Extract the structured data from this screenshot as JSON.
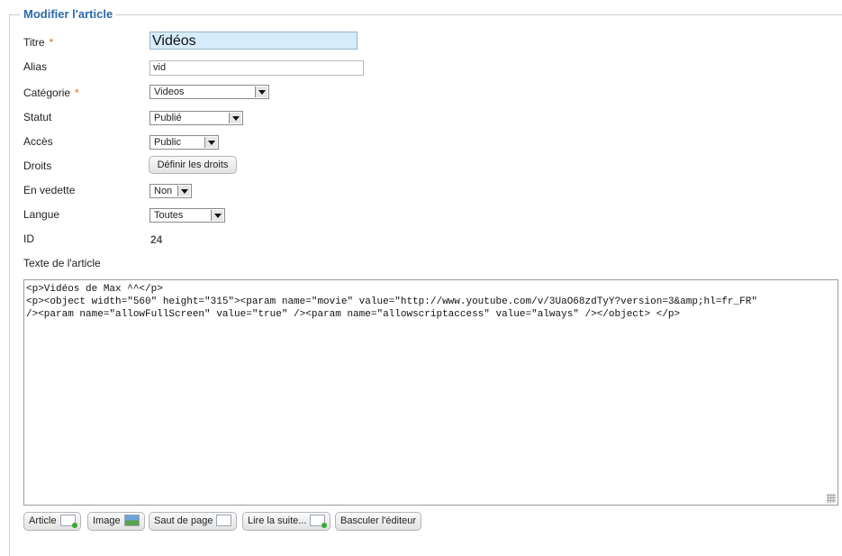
{
  "form": {
    "legend": "Modifier l'article",
    "required_marker": "*",
    "titre": {
      "label": "Titre",
      "value": "Vidéos"
    },
    "alias": {
      "label": "Alias",
      "value": "vid"
    },
    "categorie": {
      "label": "Catégorie",
      "value": "Videos"
    },
    "statut": {
      "label": "Statut",
      "value": "Publié"
    },
    "acces": {
      "label": "Accès",
      "value": "Public"
    },
    "droits": {
      "label": "Droits",
      "button": "Définir les droits"
    },
    "vedette": {
      "label": "En vedette",
      "value": "Non"
    },
    "langue": {
      "label": "Langue",
      "value": "Toutes"
    },
    "id": {
      "label": "ID",
      "value": "24"
    },
    "texte": {
      "label": "Texte de l'article",
      "content": "<p>Vidéos de Max ^^</p>\n<p><object width=\"560\" height=\"315\"><param name=\"movie\" value=\"http://www.youtube.com/v/3UaO68zdTyY?version=3&amp;hl=fr_FR\"\n/><param name=\"allowFullScreen\" value=\"true\" /><param name=\"allowscriptaccess\" value=\"always\" /></object> </p>"
    }
  },
  "editor_buttons": {
    "article": "Article",
    "image": "Image",
    "saut": "Saut de page",
    "lire": "Lire la suite...",
    "basculer": "Basculer l'éditeur"
  },
  "colors": {
    "legend": "#2c68a8",
    "required": "#e36a1a",
    "title_bg": "#d7ecfb"
  }
}
